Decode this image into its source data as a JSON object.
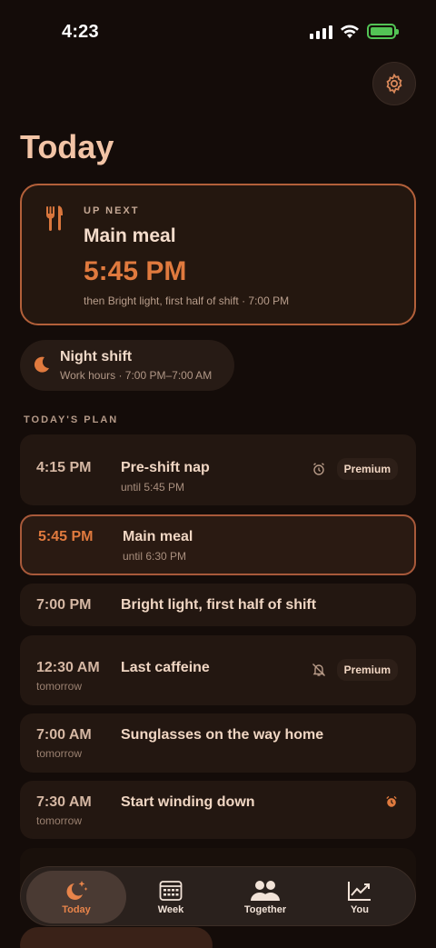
{
  "status_bar": {
    "time": "4:23"
  },
  "page": {
    "title": "Today"
  },
  "up_next": {
    "kicker": "UP NEXT",
    "title": "Main meal",
    "time": "5:45 PM",
    "subtitle": "then Bright light, first half of shift · 7:00 PM"
  },
  "shift": {
    "title": "Night shift",
    "hours": "Work hours · 7:00 PM–7:00 AM"
  },
  "plan": {
    "label": "TODAY'S PLAN",
    "items": [
      {
        "time": "4:15 PM",
        "time_sub": "",
        "title": "Pre-shift nap",
        "subtitle": "until 5:45 PM",
        "badge": "Premium",
        "icon": "alarm-icon"
      },
      {
        "time": "5:45 PM",
        "time_sub": "",
        "title": "Main meal",
        "subtitle": "until 6:30 PM",
        "badge": "",
        "icon": ""
      },
      {
        "time": "7:00 PM",
        "time_sub": "",
        "title": "Bright light, first half of shift",
        "subtitle": "",
        "badge": "",
        "icon": ""
      },
      {
        "time": "12:30 AM",
        "time_sub": "tomorrow",
        "title": "Last caffeine",
        "subtitle": "",
        "badge": "Premium",
        "icon": "bell-off-icon"
      },
      {
        "time": "7:00 AM",
        "time_sub": "tomorrow",
        "title": "Sunglasses on the way home",
        "subtitle": "",
        "badge": "",
        "icon": ""
      },
      {
        "time": "7:30 AM",
        "time_sub": "tomorrow",
        "title": "Start winding down",
        "subtitle": "",
        "badge": "",
        "icon": "alarm-filled-icon"
      }
    ]
  },
  "tabs": [
    {
      "label": "Today",
      "icon": "moon-stars-icon",
      "active": true
    },
    {
      "label": "Week",
      "icon": "calendar-icon",
      "active": false
    },
    {
      "label": "Together",
      "icon": "people-icon",
      "active": false
    },
    {
      "label": "You",
      "icon": "chart-icon",
      "active": false
    }
  ],
  "colors": {
    "accent": "#e07a3e",
    "background": "#140c09",
    "card": "#231711"
  }
}
